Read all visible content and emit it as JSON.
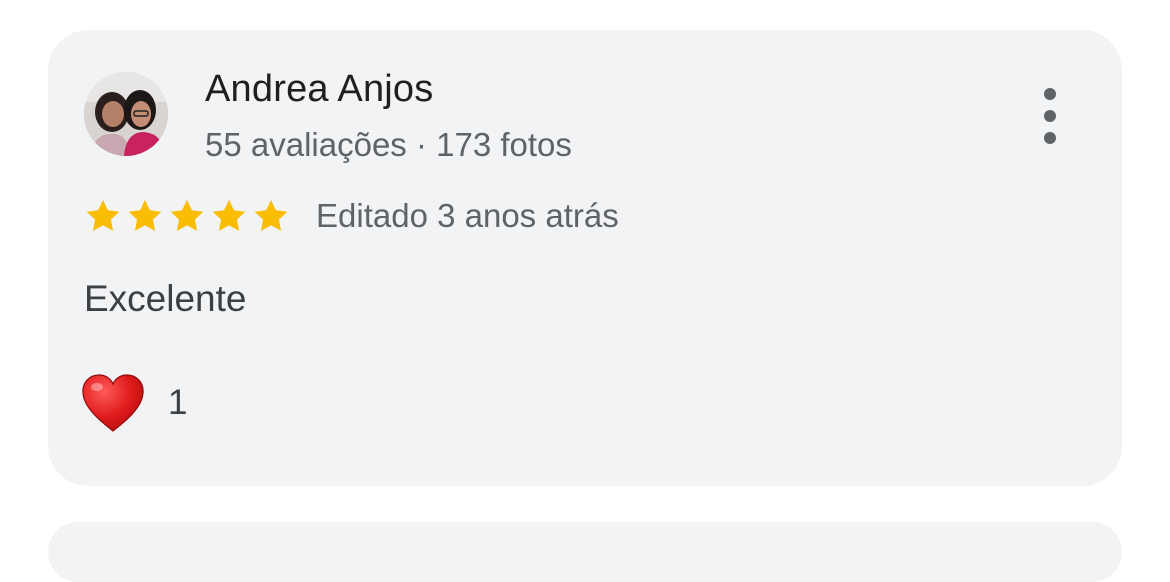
{
  "review": {
    "author_name": "Andrea Anjos",
    "author_meta": "55 avaliações · 173 fotos",
    "rating": 5,
    "rating_max": 5,
    "star_color": "#fbbc04",
    "edited_time": "Editado 3 anos atrás",
    "text": "Excelente",
    "reaction": {
      "icon": "heart-icon",
      "count": "1"
    }
  },
  "icons": {
    "more_options": "more-vert-icon",
    "star": "star-icon"
  }
}
